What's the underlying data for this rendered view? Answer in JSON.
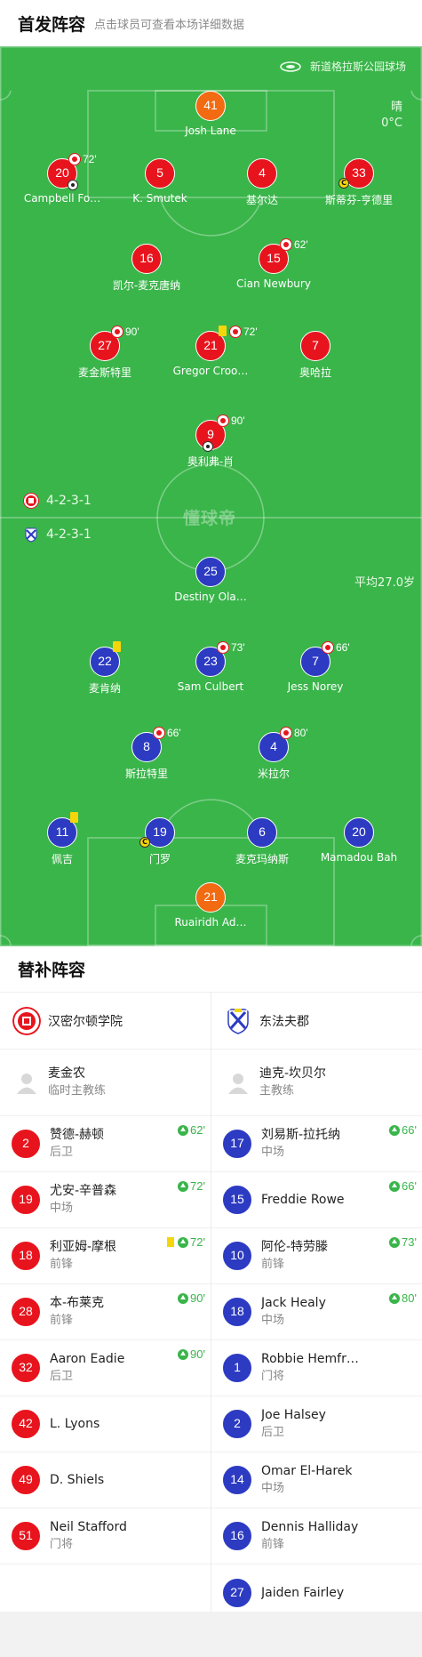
{
  "header": {
    "title": "首发阵容",
    "subtitle": "点击球员可查看本场详细数据"
  },
  "pitch": {
    "stadium": "新道格拉斯公园球场",
    "weather": {
      "condition": "晴",
      "temperature": "0°C"
    },
    "watermark": "懂球帝",
    "home_formation": "4-2-3-1",
    "away_formation": "4-2-3-1",
    "avg_age": "平均27.0岁",
    "home_players": [
      {
        "num": "41",
        "name": "Josh Lane",
        "color": "orange"
      },
      {
        "num": "20",
        "name": "Campbell Fo…",
        "sub": "72'"
      },
      {
        "num": "5",
        "name": "K. Smutek"
      },
      {
        "num": "4",
        "name": "基尔达"
      },
      {
        "num": "33",
        "name": "斯蒂芬-亨德里"
      },
      {
        "num": "16",
        "name": "凯尔-麦克唐纳"
      },
      {
        "num": "15",
        "name": "Cian Newbury",
        "sub": "62'"
      },
      {
        "num": "27",
        "name": "麦金斯特里",
        "sub": "90'"
      },
      {
        "num": "21",
        "name": "Gregor Croo…",
        "sub": "72'"
      },
      {
        "num": "7",
        "name": "奥哈拉"
      },
      {
        "num": "9",
        "name": "奥利弗-肖",
        "sub": "90'"
      }
    ],
    "away_players": [
      {
        "num": "25",
        "name": "Destiny Ola…"
      },
      {
        "num": "22",
        "name": "麦肯纳"
      },
      {
        "num": "23",
        "name": "Sam Culbert",
        "sub": "73'"
      },
      {
        "num": "7",
        "name": "Jess Norey",
        "sub": "66'"
      },
      {
        "num": "8",
        "name": "斯拉特里",
        "sub": "66'"
      },
      {
        "num": "4",
        "name": "米拉尔",
        "sub": "80'"
      },
      {
        "num": "11",
        "name": "佩吉"
      },
      {
        "num": "19",
        "name": "门罗"
      },
      {
        "num": "6",
        "name": "麦克玛纳斯"
      },
      {
        "num": "20",
        "name": "Mamadou Bah"
      },
      {
        "num": "21",
        "name": "Ruairidh Ad…",
        "color": "orange"
      }
    ]
  },
  "subs": {
    "title": "替补阵容",
    "home": {
      "team": "汉密尔顿学院",
      "coach": {
        "name": "麦金农",
        "role": "临时主教练"
      },
      "players": [
        {
          "num": "2",
          "name": "赞德-赫顿",
          "pos": "后卫",
          "in": "62'"
        },
        {
          "num": "19",
          "name": "尤安-辛普森",
          "pos": "中场",
          "in": "72'"
        },
        {
          "num": "18",
          "name": "利亚姆-摩根",
          "pos": "前锋",
          "in": "72'"
        },
        {
          "num": "28",
          "name": "本-布莱克",
          "pos": "前锋",
          "in": "90'"
        },
        {
          "num": "32",
          "name": "Aaron Eadie",
          "pos": "后卫",
          "in": "90'"
        },
        {
          "num": "42",
          "name": "L. Lyons",
          "pos": ""
        },
        {
          "num": "49",
          "name": "D. Shiels",
          "pos": ""
        },
        {
          "num": "51",
          "name": "Neil Stafford",
          "pos": "门将"
        }
      ]
    },
    "away": {
      "team": "东法夫郡",
      "coach": {
        "name": "迪克-坎贝尔",
        "role": "主教练"
      },
      "players": [
        {
          "num": "17",
          "name": "刘易斯-拉托纳",
          "pos": "中场",
          "in": "66'"
        },
        {
          "num": "15",
          "name": "Freddie Rowe",
          "pos": "",
          "in": "66'"
        },
        {
          "num": "10",
          "name": "阿伦-特劳滕",
          "pos": "前锋",
          "in": "73'"
        },
        {
          "num": "18",
          "name": "Jack Healy",
          "pos": "中场",
          "in": "80'"
        },
        {
          "num": "1",
          "name": "Robbie Hemfr…",
          "pos": "门将"
        },
        {
          "num": "2",
          "name": "Joe Halsey",
          "pos": "后卫"
        },
        {
          "num": "14",
          "name": "Omar El-Harek",
          "pos": "中场"
        },
        {
          "num": "16",
          "name": "Dennis Halliday",
          "pos": "前锋"
        },
        {
          "num": "27",
          "name": "Jaiden Fairley",
          "pos": ""
        }
      ]
    }
  },
  "colors": {
    "pitch": "#3ab54a",
    "home": "#e8141d",
    "away": "#2c3bc2",
    "goalkeeper": "#f26a11",
    "sub_in": "#3ab54a",
    "yellow_card": "#f4d60b"
  }
}
